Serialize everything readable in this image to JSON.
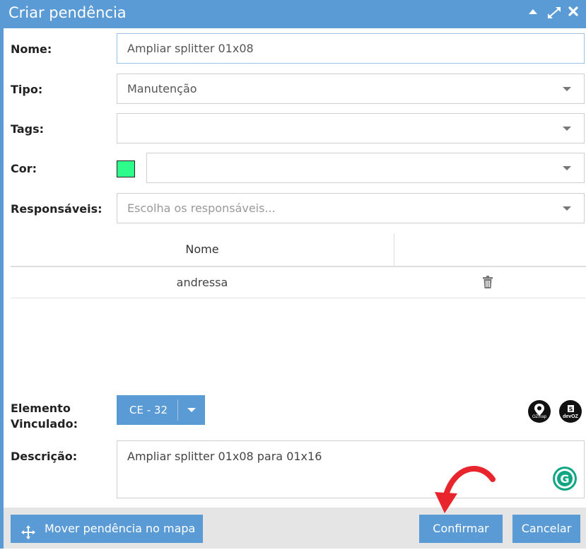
{
  "dialog": {
    "title": "Criar pendência",
    "controls": [
      "collapse-icon",
      "expand-icon",
      "close-icon"
    ]
  },
  "form": {
    "nome": {
      "label": "Nome:",
      "value": "Ampliar splitter 01x08"
    },
    "tipo": {
      "label": "Tipo:",
      "value": "Manutenção"
    },
    "tags": {
      "label": "Tags:",
      "value": ""
    },
    "cor": {
      "label": "Cor:",
      "value": "",
      "swatch_color": "#2efc8a"
    },
    "responsaveis": {
      "label": "Responsáveis:",
      "placeholder": "Escolha os responsáveis..."
    }
  },
  "table": {
    "headers": [
      "Nome",
      ""
    ],
    "rows": [
      {
        "name": "andressa",
        "action_icon": "trash-icon"
      }
    ]
  },
  "elemento": {
    "label_line1": "Elemento",
    "label_line2": "Vinculado:",
    "value": "CE - 32",
    "badges": [
      {
        "name": "ozmap-badge",
        "text": "OZmap"
      },
      {
        "name": "devoz-badge",
        "text": "devOZ"
      }
    ]
  },
  "descricao": {
    "label": "Descrição:",
    "value": "Ampliar splitter 01x08 para 01x16"
  },
  "footer": {
    "move_label": "Mover pendência no mapa",
    "confirm_label": "Confirmar",
    "cancel_label": "Cancelar"
  },
  "colors": {
    "accent": "#5b9bd5",
    "annotation_arrow": "#e8242c"
  }
}
